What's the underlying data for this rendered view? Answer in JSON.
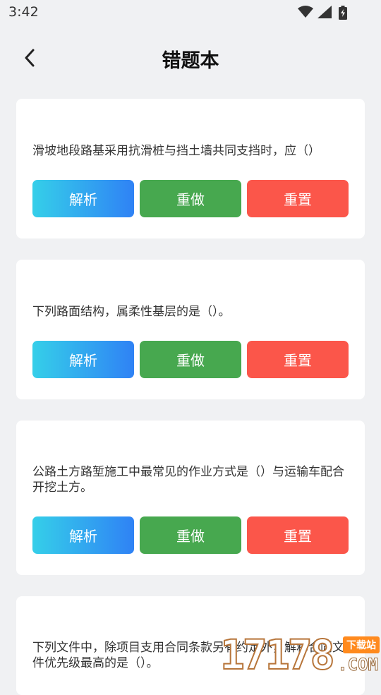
{
  "status_bar": {
    "time": "3:42",
    "icons": [
      "wifi-icon",
      "signal-icon",
      "battery-charging-icon"
    ]
  },
  "header": {
    "title": "错题本",
    "back_icon": "chevron-left-icon"
  },
  "buttons": {
    "analyze_label": "解析",
    "redo_label": "重做",
    "reset_label": "重置"
  },
  "questions": [
    {
      "text": "滑坡地段路基采用抗滑桩与挡土墙共同支挡时，应（）"
    },
    {
      "text": "下列路面结构，属柔性基层的是（）。"
    },
    {
      "text": "公路土方路堑施工中最常见的作业方式是（）与运输车配合开挖土方。"
    },
    {
      "text": "下列文件中，除项目支用合同条款另有约定外，解释合同文件优先级最高的是（）。"
    }
  ],
  "watermark": {
    "number": "17178",
    "tag": "下载站",
    "suffix": ".COM"
  },
  "colors": {
    "background": "#f0f1f3",
    "analyze_gradient_start": "#35cfe9",
    "analyze_gradient_end": "#2f82f5",
    "redo": "#47a84f",
    "reset": "#fb564a"
  }
}
